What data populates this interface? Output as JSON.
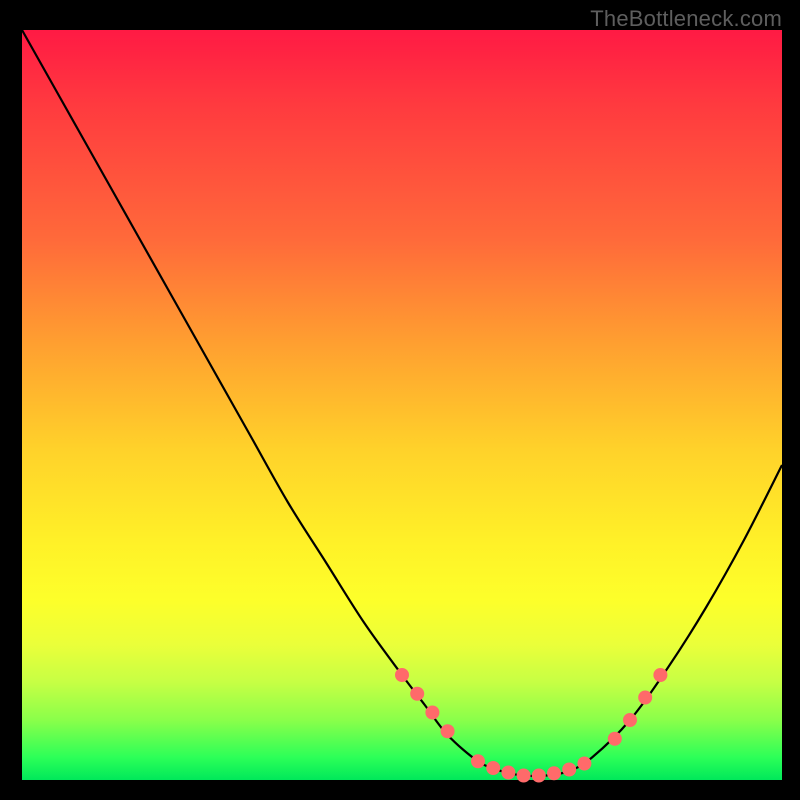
{
  "watermark": "TheBottleneck.com",
  "colors": {
    "curve": "#000000",
    "marker_fill": "#ff6a6a",
    "marker_stroke": "#ff6a6a",
    "background_black": "#000000"
  },
  "chart_data": {
    "type": "line",
    "title": "",
    "xlabel": "",
    "ylabel": "",
    "xlim": [
      0,
      100
    ],
    "ylim": [
      0,
      100
    ],
    "note": "No numeric axis ticks are shown; y interpreted as bottleneck % (0=bottom green, 100=top red). Curve shape estimated from pixels.",
    "series": [
      {
        "name": "bottleneck-curve",
        "x": [
          0,
          5,
          10,
          15,
          20,
          25,
          30,
          35,
          40,
          45,
          50,
          53,
          56,
          60,
          63,
          66,
          69,
          72,
          75,
          80,
          85,
          90,
          95,
          100
        ],
        "y": [
          100,
          91,
          82,
          73,
          64,
          55,
          46,
          37,
          29,
          21,
          14,
          10,
          6,
          2.5,
          1.2,
          0.6,
          0.6,
          1.2,
          3,
          8,
          15,
          23,
          32,
          42
        ]
      }
    ],
    "markers": {
      "name": "highlight-dots",
      "x": [
        50,
        52,
        54,
        56,
        60,
        62,
        64,
        66,
        68,
        70,
        72,
        74,
        78,
        80,
        82,
        84
      ],
      "y": [
        14,
        11.5,
        9,
        6.5,
        2.5,
        1.6,
        1.0,
        0.6,
        0.6,
        0.9,
        1.4,
        2.2,
        5.5,
        8,
        11,
        14
      ]
    }
  }
}
